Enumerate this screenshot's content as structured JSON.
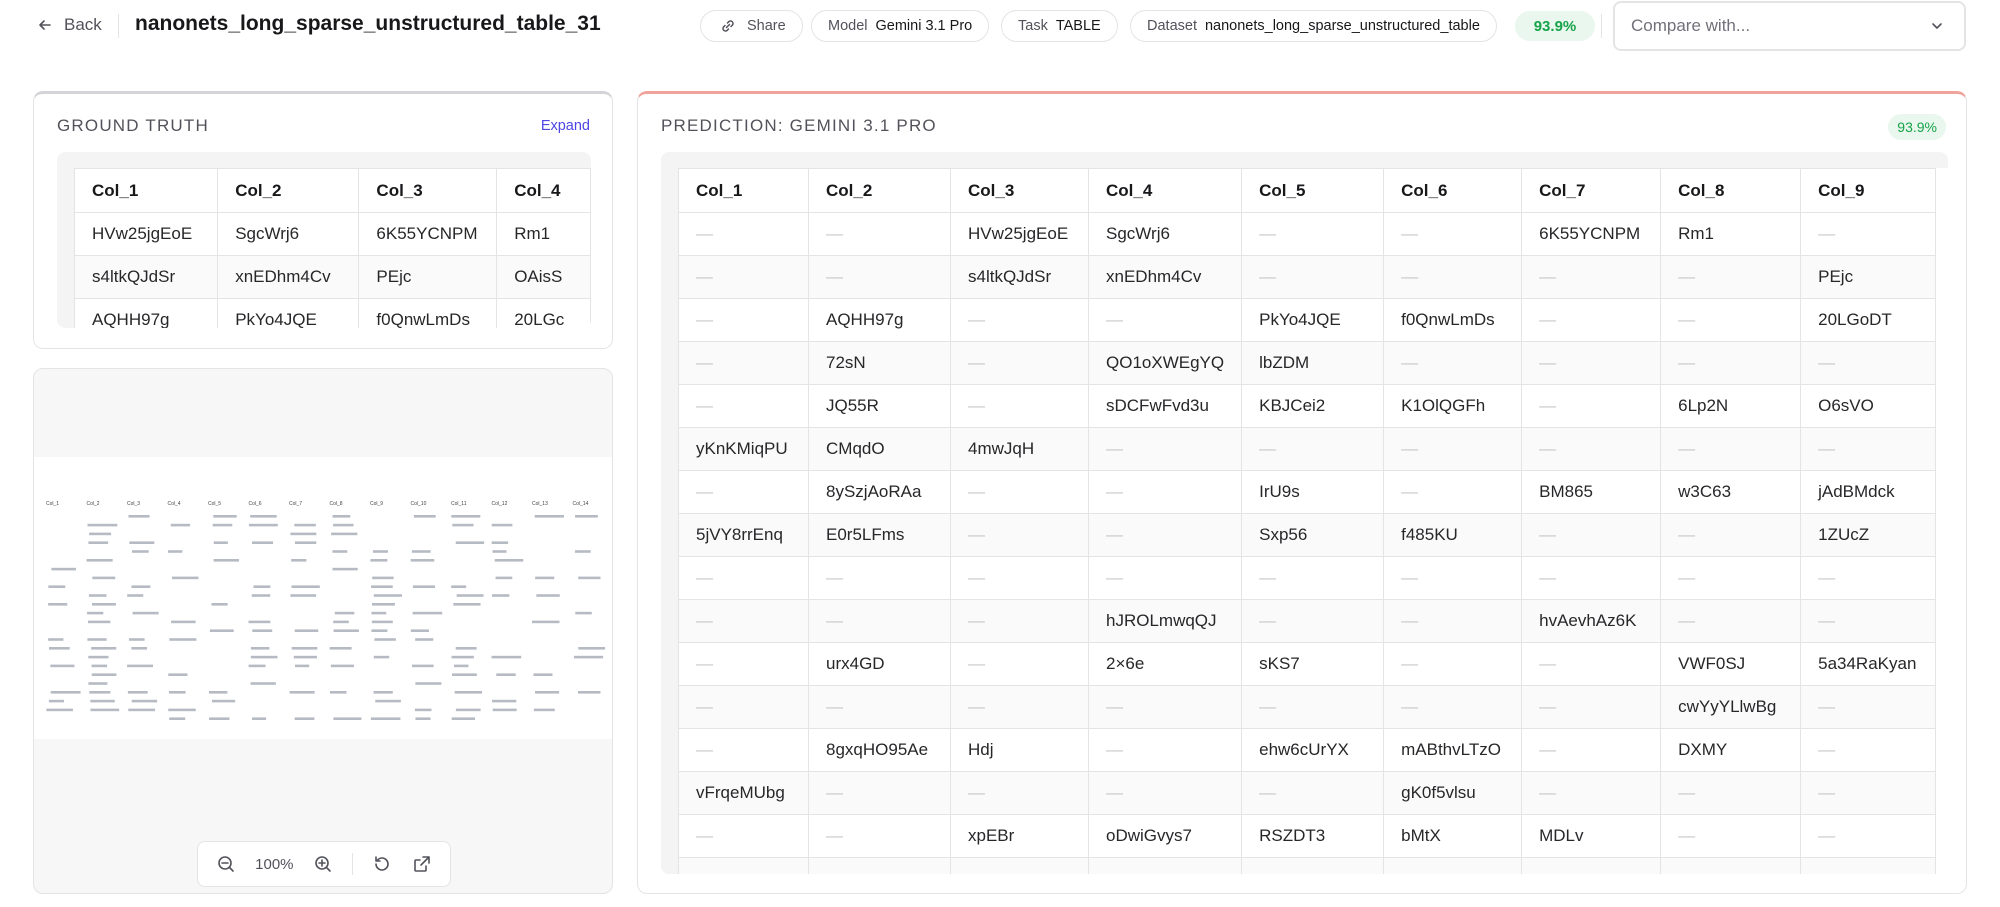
{
  "topbar": {
    "back_label": "Back",
    "title": "nanonets_long_sparse_unstructured_table_31",
    "share_label": "Share",
    "model_key": "Model",
    "model_value": "Gemini 3.1 Pro",
    "task_key": "Task",
    "task_value": "TABLE",
    "dataset_key": "Dataset",
    "dataset_value": "nanonets_long_sparse_unstructured_table",
    "score": "93.9%",
    "compare_placeholder": "Compare with..."
  },
  "ground_truth": {
    "title": "GROUND TRUTH",
    "expand_label": "Expand",
    "headers": [
      "Col_1",
      "Col_2",
      "Col_3",
      "Col_4"
    ],
    "rows": [
      [
        "HVw25jgEoE",
        "SgcWrj6",
        "6K55YCNPM",
        "Rm1"
      ],
      [
        "s4ltkQJdSr",
        "xnEDhm4Cv",
        "PEjc",
        "OAisS"
      ],
      [
        "AQHH97g",
        "PkYo4JQE",
        "f0QnwLmDs",
        "20LGc"
      ]
    ]
  },
  "prediction": {
    "title": "PREDICTION: GEMINI 3.1 PRO",
    "score": "93.9%",
    "headers": [
      "Col_1",
      "Col_2",
      "Col_3",
      "Col_4",
      "Col_5",
      "Col_6",
      "Col_7",
      "Col_8",
      "Col_9"
    ],
    "rows": [
      [
        "—",
        "—",
        "HVw25jgEoE",
        "SgcWrj6",
        "—",
        "—",
        "6K55YCNPM",
        "Rm1",
        "—"
      ],
      [
        "—",
        "—",
        "s4ltkQJdSr",
        "xnEDhm4Cv",
        "—",
        "—",
        "—",
        "—",
        "PEjc"
      ],
      [
        "—",
        "AQHH97g",
        "—",
        "—",
        "PkYo4JQE",
        "f0QnwLmDs",
        "—",
        "—",
        "20LGoDT"
      ],
      [
        "—",
        "72sN",
        "—",
        "QO1oXWEgYQ",
        "lbZDM",
        "—",
        "—",
        "—",
        "—"
      ],
      [
        "—",
        "JQ55R",
        "—",
        "sDCFwFvd3u",
        "KBJCei2",
        "K1OlQGFh",
        "—",
        "6Lp2N",
        "O6sVO"
      ],
      [
        "yKnKMiqPU",
        "CMqdO",
        "4mwJqH",
        "—",
        "—",
        "—",
        "—",
        "—",
        "—"
      ],
      [
        "—",
        "8ySzjAoRAa",
        "—",
        "—",
        "IrU9s",
        "—",
        "BM865",
        "w3C63",
        "jAdBMdck"
      ],
      [
        "5jVY8rrEnq",
        "E0r5LFms",
        "—",
        "—",
        "Sxp56",
        "f485KU",
        "—",
        "—",
        "1ZUcZ"
      ],
      [
        "—",
        "—",
        "—",
        "—",
        "—",
        "—",
        "—",
        "—",
        "—"
      ],
      [
        "—",
        "—",
        "—",
        "hJROLmwqQJ",
        "—",
        "—",
        "hvAevhAz6K",
        "—",
        "—"
      ],
      [
        "—",
        "urx4GD",
        "—",
        "2×6e",
        "sKS7",
        "—",
        "—",
        "VWF0SJ",
        "5a34RaKyan"
      ],
      [
        "—",
        "—",
        "—",
        "—",
        "—",
        "—",
        "—",
        "cwYyYLlwBg",
        "—"
      ],
      [
        "—",
        "8gxqHO95Ae",
        "Hdj",
        "—",
        "ehw6cUrYX",
        "mABthvLTzO",
        "—",
        "DXMY",
        "—"
      ],
      [
        "vFrqeMUbg",
        "—",
        "—",
        "—",
        "—",
        "gK0f5vlsu",
        "—",
        "—",
        "—"
      ],
      [
        "—",
        "—",
        "xpEBr",
        "oDwiGvys7",
        "RSZDT3",
        "bMtX",
        "MDLv",
        "—",
        "—"
      ],
      [
        "",
        "",
        "",
        "",
        "",
        "",
        "",
        "",
        ""
      ]
    ]
  },
  "image_viewer": {
    "zoom": "100%",
    "thumb_headers": [
      "Col_1",
      "Col_2",
      "Col_3",
      "Col_4",
      "Col_5",
      "Col_6",
      "Col_7",
      "Col_8",
      "Col_9",
      "Col_10",
      "Col_11",
      "Col_12",
      "Col_13",
      "Col_14"
    ]
  },
  "icons": {
    "back": "arrow-left-icon",
    "share": "link-icon",
    "compare": "chevron-down-icon",
    "zoom_out": "zoom-out-icon",
    "zoom_in": "zoom-in-icon",
    "reset": "rotate-ccw-icon",
    "open": "external-link-icon"
  },
  "colors": {
    "score_green": "#16a34a",
    "accent_indigo": "#4f46e5",
    "prediction_border": "#f0a39a"
  }
}
